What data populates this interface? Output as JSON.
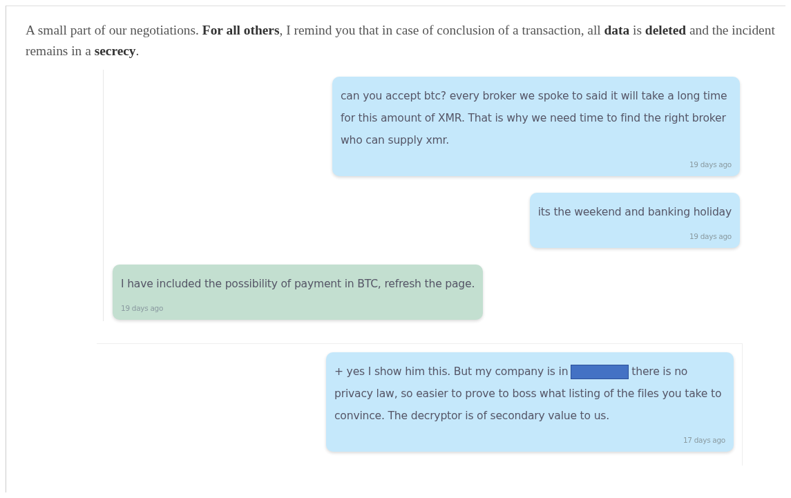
{
  "intro_lines": [
    "A small part of our negotiations. **For all others**, I remind you that in case of conclusion of a transaction, all **data** is **deleted** and the incident",
    "remains in a **secrecy**."
  ],
  "threads": [
    {
      "messages": [
        {
          "kind": "sent",
          "parts": [
            {
              "kind": "text",
              "text": "can you accept btc? every broker we spoke to said it will take a long time for this amount of XMR. That is why we need time to find the right broker who can supply xmr."
            }
          ],
          "time": "19 days ago"
        },
        {
          "kind": "sent",
          "parts": [
            {
              "kind": "text",
              "text": "its the weekend and banking holiday"
            }
          ],
          "time": "19 days ago"
        },
        {
          "kind": "received",
          "parts": [
            {
              "kind": "text",
              "text": "I have included the possibility of payment in BTC, refresh the page."
            }
          ],
          "time": "19 days ago"
        }
      ]
    },
    {
      "messages": [
        {
          "kind": "sent",
          "parts": [
            {
              "kind": "text",
              "text": "+ yes I show him this. But my company is in"
            },
            {
              "kind": "redacted"
            },
            {
              "kind": "text",
              "text": "there is no"
            },
            {
              "kind": "paragraph",
              "text": "privacy law, so easier to prove to boss what listing of the files you take to convince. The decryptor is of secondary value to us."
            }
          ],
          "time": "17 days ago"
        }
      ]
    }
  ]
}
